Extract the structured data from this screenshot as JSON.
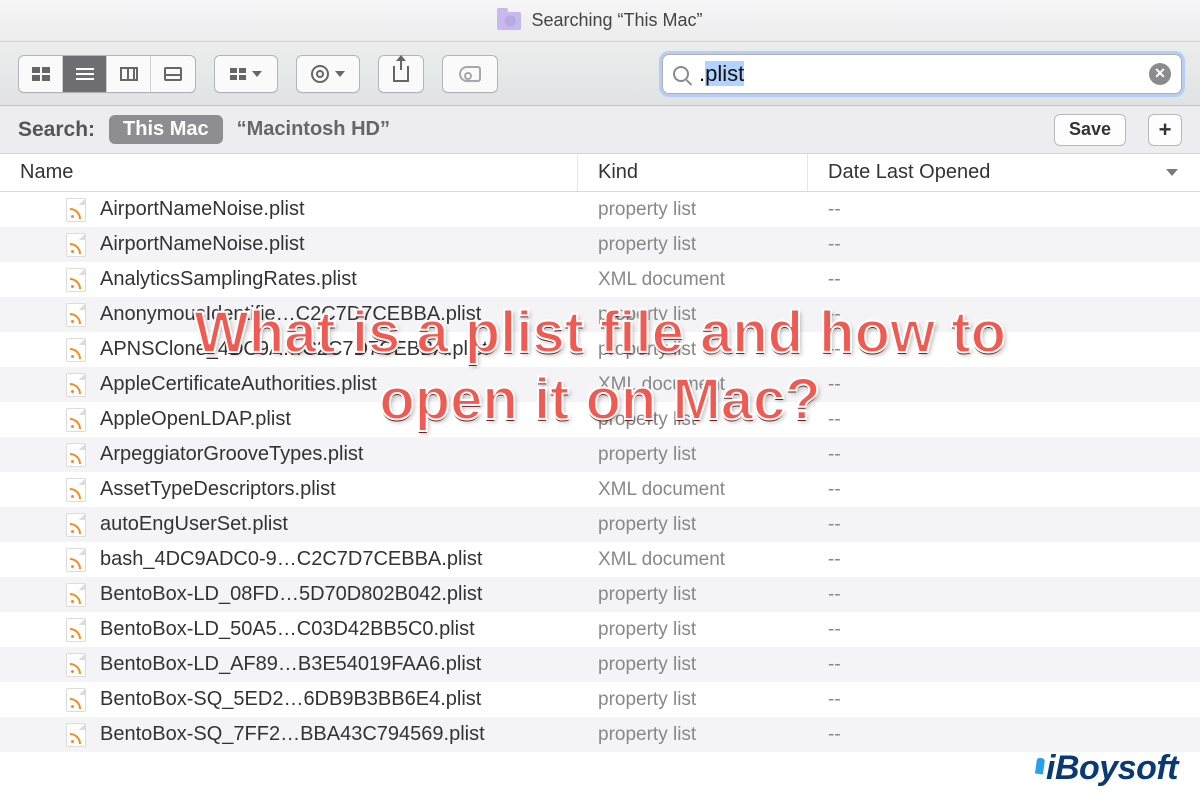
{
  "window": {
    "title": "Searching “This Mac”"
  },
  "search": {
    "query_prefix": ".",
    "query_selected": "plist"
  },
  "scope": {
    "label": "Search:",
    "active": "This Mac",
    "other": "“Macintosh HD”",
    "save_label": "Save",
    "plus_label": "+"
  },
  "columns": {
    "name": "Name",
    "kind": "Kind",
    "date": "Date Last Opened"
  },
  "rows": [
    {
      "name": "AirportNameNoise.plist",
      "kind": "property list",
      "date": "--"
    },
    {
      "name": "AirportNameNoise.plist",
      "kind": "property list",
      "date": "--"
    },
    {
      "name": "AnalyticsSamplingRates.plist",
      "kind": "XML document",
      "date": "--"
    },
    {
      "name": "AnonymousIdentifie…C2C7D7CEBBA.plist",
      "kind": "property list",
      "date": "--"
    },
    {
      "name": "APNSClone_4DC9A…C2C7D7CEBBA.plist",
      "kind": "property list",
      "date": "--"
    },
    {
      "name": "AppleCertificateAuthorities.plist",
      "kind": "XML document",
      "date": "--"
    },
    {
      "name": "AppleOpenLDAP.plist",
      "kind": "property list",
      "date": "--"
    },
    {
      "name": "ArpeggiatorGrooveTypes.plist",
      "kind": "property list",
      "date": "--"
    },
    {
      "name": "AssetTypeDescriptors.plist",
      "kind": "XML document",
      "date": "--"
    },
    {
      "name": "autoEngUserSet.plist",
      "kind": "property list",
      "date": "--"
    },
    {
      "name": "bash_4DC9ADC0-9…C2C7D7CEBBA.plist",
      "kind": "XML document",
      "date": "--"
    },
    {
      "name": "BentoBox-LD_08FD…5D70D802B042.plist",
      "kind": "property list",
      "date": "--"
    },
    {
      "name": "BentoBox-LD_50A5…C03D42BB5C0.plist",
      "kind": "property list",
      "date": "--"
    },
    {
      "name": "BentoBox-LD_AF89…B3E54019FAA6.plist",
      "kind": "property list",
      "date": "--"
    },
    {
      "name": "BentoBox-SQ_5ED2…6DB9B3BB6E4.plist",
      "kind": "property list",
      "date": "--"
    },
    {
      "name": "BentoBox-SQ_7FF2…BBA43C794569.plist",
      "kind": "property list",
      "date": "--"
    }
  ],
  "overlay": {
    "line1": "What is a plist file and how to",
    "line2": "open it on Mac?"
  },
  "watermark": "iBoysoft"
}
